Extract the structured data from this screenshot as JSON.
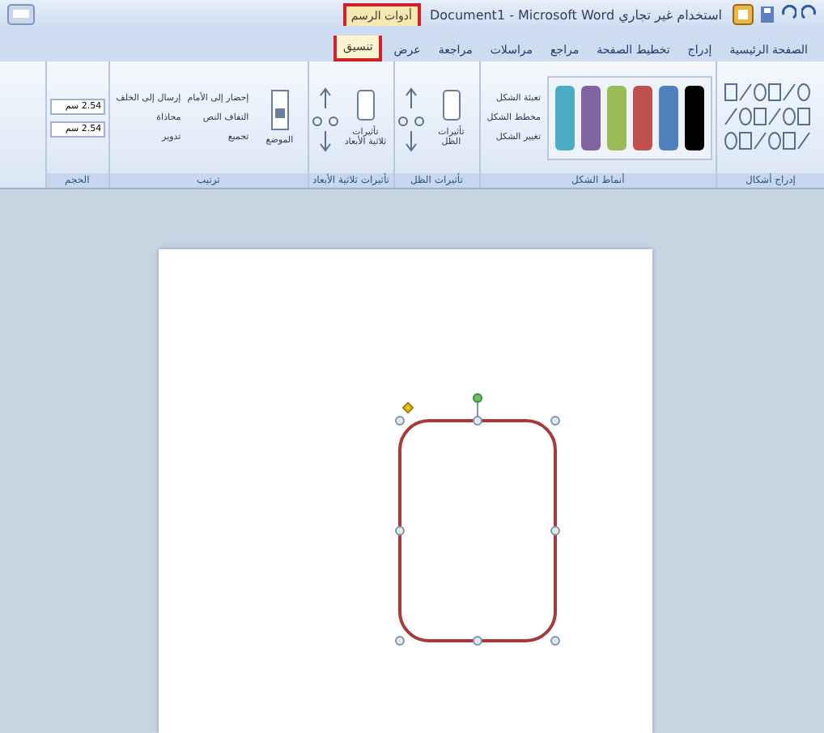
{
  "window": {
    "title": "Document1 - Microsoft Word استخدام غير تجاري",
    "contextual_group": "أدوات الرسم"
  },
  "tabs": [
    {
      "label": "الصفحة الرئيسية",
      "selected": false,
      "contextual": false
    },
    {
      "label": "إدراج",
      "selected": false,
      "contextual": false
    },
    {
      "label": "تخطيط الصفحة",
      "selected": false,
      "contextual": false
    },
    {
      "label": "مراجع",
      "selected": false,
      "contextual": false
    },
    {
      "label": "مراسلات",
      "selected": false,
      "contextual": false
    },
    {
      "label": "مراجعة",
      "selected": false,
      "contextual": false
    },
    {
      "label": "عرض",
      "selected": false,
      "contextual": false
    },
    {
      "label": "تنسيق",
      "selected": true,
      "contextual": true
    }
  ],
  "ribbon": {
    "groups": [
      {
        "kind": "shapes",
        "label": "إدراج أشكال"
      },
      {
        "kind": "styles",
        "label": "أنماط الشكل",
        "swatches": [
          {
            "color": "#000000"
          },
          {
            "color": "#4f81bd"
          },
          {
            "color": "#c0504d"
          },
          {
            "color": "#9bbb59"
          },
          {
            "color": "#8064a2"
          },
          {
            "color": "#4bacc6"
          }
        ],
        "commands": [
          "تعبئة الشكل",
          "مخطط الشكل",
          "تغيير الشكل"
        ]
      },
      {
        "kind": "effect",
        "label": "تأثيرات الظل",
        "button": "تأثيرات الظل"
      },
      {
        "kind": "effect",
        "label": "تأثيرات ثلاثية الأبعاد",
        "button": "تأثيرات ثلاثية الأبعاد"
      },
      {
        "kind": "arrange",
        "label": "ترتيب",
        "button": "الموضع",
        "commands": [
          "إحضار إلى الأمام",
          "إرسال إلى الخلف",
          "التفاف النص",
          "محاذاة",
          "تجميع",
          "تدوير"
        ]
      },
      {
        "kind": "size",
        "label": "الحجم",
        "fields": [
          "2.54 سم",
          "2.54 سم"
        ]
      }
    ]
  },
  "document": {
    "shape": {
      "kind": "rounded-rectangle",
      "selected": true
    }
  }
}
